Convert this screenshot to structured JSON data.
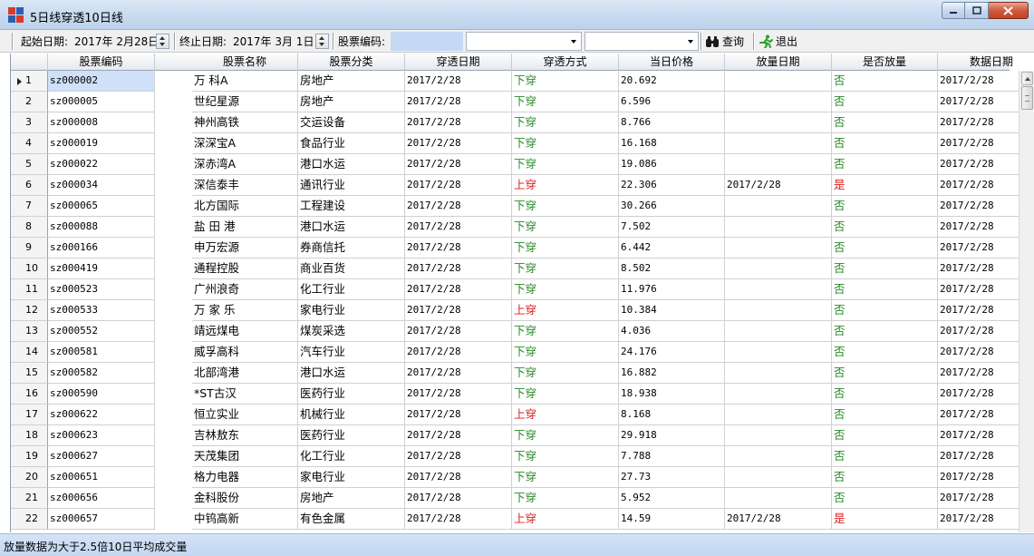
{
  "window": {
    "title": "5日线穿透10日线"
  },
  "toolbar": {
    "start_label": "起始日期:",
    "start_value": "2017年  2月28日",
    "end_label": "终止日期:",
    "end_value": "2017年  3月  1日",
    "code_label": "股票编码:",
    "code_value": "",
    "combo1_value": "",
    "combo2_value": "",
    "query_label": "查询",
    "exit_label": "退出"
  },
  "table": {
    "columns": [
      "股票编码",
      "股票名称",
      "股票分类",
      "穿透日期",
      "穿透方式",
      "当日价格",
      "放量日期",
      "是否放量",
      "数据日期"
    ],
    "rows": [
      {
        "n": "1",
        "code": "sz000002",
        "name": "万  科A",
        "cat": "房地产",
        "date": "2017/2/28",
        "mode": "下穿",
        "price": "20.692",
        "vol_date": "",
        "vol": "否",
        "data_date": "2017/2/28"
      },
      {
        "n": "2",
        "code": "sz000005",
        "name": "世纪星源",
        "cat": "房地产",
        "date": "2017/2/28",
        "mode": "下穿",
        "price": "6.596",
        "vol_date": "",
        "vol": "否",
        "data_date": "2017/2/28"
      },
      {
        "n": "3",
        "code": "sz000008",
        "name": "神州高铁",
        "cat": "交运设备",
        "date": "2017/2/28",
        "mode": "下穿",
        "price": "8.766",
        "vol_date": "",
        "vol": "否",
        "data_date": "2017/2/28"
      },
      {
        "n": "4",
        "code": "sz000019",
        "name": "深深宝A",
        "cat": "食品行业",
        "date": "2017/2/28",
        "mode": "下穿",
        "price": "16.168",
        "vol_date": "",
        "vol": "否",
        "data_date": "2017/2/28"
      },
      {
        "n": "5",
        "code": "sz000022",
        "name": "深赤湾A",
        "cat": "港口水运",
        "date": "2017/2/28",
        "mode": "下穿",
        "price": "19.086",
        "vol_date": "",
        "vol": "否",
        "data_date": "2017/2/28"
      },
      {
        "n": "6",
        "code": "sz000034",
        "name": "深信泰丰",
        "cat": "通讯行业",
        "date": "2017/2/28",
        "mode": "上穿",
        "price": "22.306",
        "vol_date": "2017/2/28",
        "vol": "是",
        "data_date": "2017/2/28"
      },
      {
        "n": "7",
        "code": "sz000065",
        "name": "北方国际",
        "cat": "工程建设",
        "date": "2017/2/28",
        "mode": "下穿",
        "price": "30.266",
        "vol_date": "",
        "vol": "否",
        "data_date": "2017/2/28"
      },
      {
        "n": "8",
        "code": "sz000088",
        "name": "盐 田 港",
        "cat": "港口水运",
        "date": "2017/2/28",
        "mode": "下穿",
        "price": "7.502",
        "vol_date": "",
        "vol": "否",
        "data_date": "2017/2/28"
      },
      {
        "n": "9",
        "code": "sz000166",
        "name": "申万宏源",
        "cat": "券商信托",
        "date": "2017/2/28",
        "mode": "下穿",
        "price": "6.442",
        "vol_date": "",
        "vol": "否",
        "data_date": "2017/2/28"
      },
      {
        "n": "10",
        "code": "sz000419",
        "name": "通程控股",
        "cat": "商业百货",
        "date": "2017/2/28",
        "mode": "下穿",
        "price": "8.502",
        "vol_date": "",
        "vol": "否",
        "data_date": "2017/2/28"
      },
      {
        "n": "11",
        "code": "sz000523",
        "name": "广州浪奇",
        "cat": "化工行业",
        "date": "2017/2/28",
        "mode": "下穿",
        "price": "11.976",
        "vol_date": "",
        "vol": "否",
        "data_date": "2017/2/28"
      },
      {
        "n": "12",
        "code": "sz000533",
        "name": "万 家 乐",
        "cat": "家电行业",
        "date": "2017/2/28",
        "mode": "上穿",
        "price": "10.384",
        "vol_date": "",
        "vol": "否",
        "data_date": "2017/2/28"
      },
      {
        "n": "13",
        "code": "sz000552",
        "name": "靖远煤电",
        "cat": "煤炭采选",
        "date": "2017/2/28",
        "mode": "下穿",
        "price": "4.036",
        "vol_date": "",
        "vol": "否",
        "data_date": "2017/2/28"
      },
      {
        "n": "14",
        "code": "sz000581",
        "name": "威孚高科",
        "cat": "汽车行业",
        "date": "2017/2/28",
        "mode": "下穿",
        "price": "24.176",
        "vol_date": "",
        "vol": "否",
        "data_date": "2017/2/28"
      },
      {
        "n": "15",
        "code": "sz000582",
        "name": "北部湾港",
        "cat": "港口水运",
        "date": "2017/2/28",
        "mode": "下穿",
        "price": "16.882",
        "vol_date": "",
        "vol": "否",
        "data_date": "2017/2/28"
      },
      {
        "n": "16",
        "code": "sz000590",
        "name": "*ST古汉",
        "cat": "医药行业",
        "date": "2017/2/28",
        "mode": "下穿",
        "price": "18.938",
        "vol_date": "",
        "vol": "否",
        "data_date": "2017/2/28"
      },
      {
        "n": "17",
        "code": "sz000622",
        "name": "恒立实业",
        "cat": "机械行业",
        "date": "2017/2/28",
        "mode": "上穿",
        "price": "8.168",
        "vol_date": "",
        "vol": "否",
        "data_date": "2017/2/28"
      },
      {
        "n": "18",
        "code": "sz000623",
        "name": "吉林敖东",
        "cat": "医药行业",
        "date": "2017/2/28",
        "mode": "下穿",
        "price": "29.918",
        "vol_date": "",
        "vol": "否",
        "data_date": "2017/2/28"
      },
      {
        "n": "19",
        "code": "sz000627",
        "name": "天茂集团",
        "cat": "化工行业",
        "date": "2017/2/28",
        "mode": "下穿",
        "price": "7.788",
        "vol_date": "",
        "vol": "否",
        "data_date": "2017/2/28"
      },
      {
        "n": "20",
        "code": "sz000651",
        "name": "格力电器",
        "cat": "家电行业",
        "date": "2017/2/28",
        "mode": "下穿",
        "price": "27.73",
        "vol_date": "",
        "vol": "否",
        "data_date": "2017/2/28"
      },
      {
        "n": "21",
        "code": "sz000656",
        "name": "金科股份",
        "cat": "房地产",
        "date": "2017/2/28",
        "mode": "下穿",
        "price": "5.952",
        "vol_date": "",
        "vol": "否",
        "data_date": "2017/2/28"
      },
      {
        "n": "22",
        "code": "sz000657",
        "name": "中钨高新",
        "cat": "有色金属",
        "date": "2017/2/28",
        "mode": "上穿",
        "price": "14.59",
        "vol_date": "2017/2/28",
        "vol": "是",
        "data_date": "2017/2/28"
      }
    ]
  },
  "status": {
    "text": "放量数据为大于2.5倍10日平均成交量"
  },
  "colors": {
    "down": "#2a8a2a",
    "up": "#d92020",
    "selection": "#cfe0f8",
    "statusbar": "#c8dbf2"
  },
  "icons": {
    "app": "grid-app-icon",
    "query": "binoculars-icon",
    "exit": "running-man-icon"
  }
}
